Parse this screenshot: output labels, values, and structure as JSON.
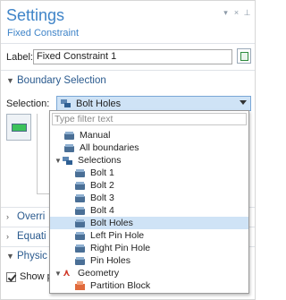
{
  "header": {
    "title": "Settings",
    "subtitle": "Fixed Constraint",
    "controls": [
      "▾",
      "×",
      "⊥"
    ]
  },
  "label": {
    "caption": "Label:",
    "value": "Fixed Constraint 1"
  },
  "boundary_section": {
    "title": "Boundary Selection"
  },
  "selection": {
    "caption": "Selection:",
    "value": "Bolt Holes"
  },
  "dropdown": {
    "filter_placeholder": "Type filter text",
    "items": [
      {
        "label": "Manual",
        "icon": "drive-icon"
      },
      {
        "label": "All boundaries",
        "icon": "drive-icon"
      },
      {
        "label": "Selections",
        "icon": "selections-icon",
        "expanded": true
      },
      {
        "label": "Bolt 1",
        "icon": "drive-icon"
      },
      {
        "label": "Bolt 2",
        "icon": "drive-icon"
      },
      {
        "label": "Bolt 3",
        "icon": "drive-icon"
      },
      {
        "label": "Bolt 4",
        "icon": "drive-icon"
      },
      {
        "label": "Bolt Holes",
        "icon": "drive-icon",
        "selected": true
      },
      {
        "label": "Left Pin Hole",
        "icon": "drive-icon"
      },
      {
        "label": "Right Pin Hole",
        "icon": "drive-icon"
      },
      {
        "label": "Pin Holes",
        "icon": "drive-icon"
      },
      {
        "label": "Geometry",
        "icon": "geometry-icon",
        "expanded": true
      },
      {
        "label": "Partition Block",
        "icon": "partition-icon"
      }
    ]
  },
  "collapsed_sections": [
    {
      "title": "Overri"
    },
    {
      "title": "Equati"
    },
    {
      "title": "Physic"
    }
  ],
  "checkbox": {
    "label": "Show pl",
    "checked": true
  },
  "colors": {
    "accent": "#3f84c8",
    "selection_bg": "#cfe3f6"
  }
}
